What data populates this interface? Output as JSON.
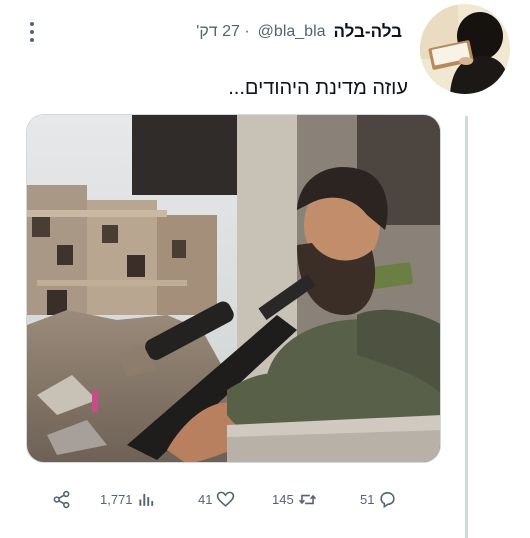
{
  "tweet": {
    "display_name": "בלה-בלה",
    "handle": "@bla_bla",
    "timestamp": "· 27 דק'",
    "text": "עוזה מדינת היהודים..."
  },
  "media": {
    "description_icon": "photo-soldier-rubble"
  },
  "actions": {
    "share_icon": "share-icon",
    "views": "1,771",
    "likes": "41",
    "retweets": "145",
    "replies": "51"
  },
  "colors": {
    "text": "#0f1419",
    "secondary": "#536471",
    "divider": "#cfd9de"
  }
}
